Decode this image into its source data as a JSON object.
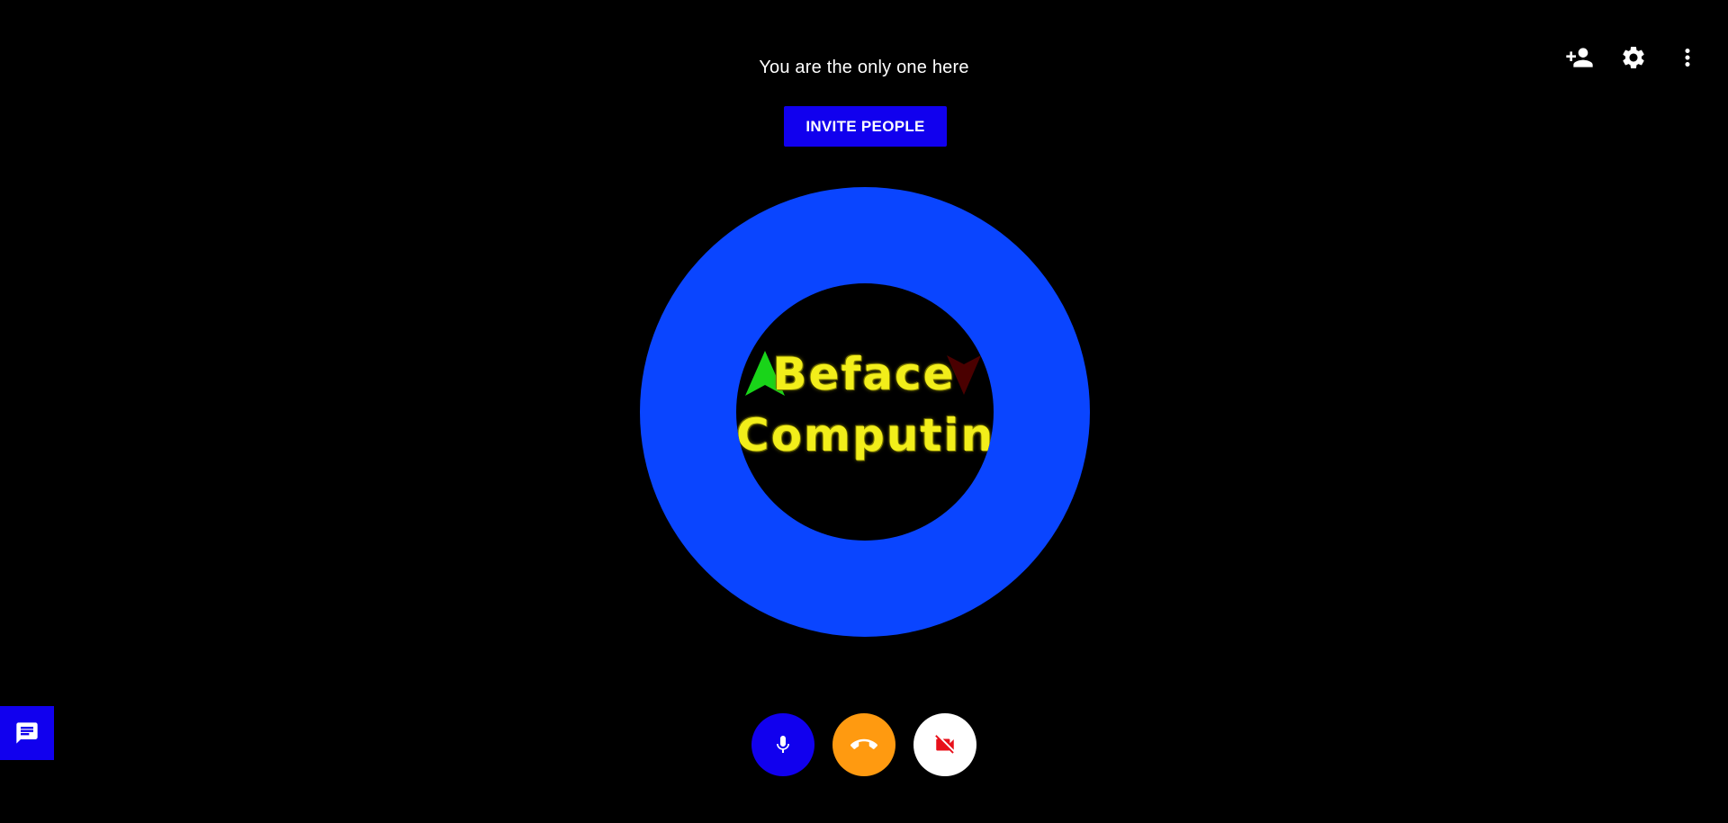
{
  "status": {
    "message": "You are the only one here"
  },
  "invite": {
    "label": "INVITE PEOPLE"
  },
  "top_actions": [
    {
      "icon": "add-person-icon"
    },
    {
      "icon": "gear-icon"
    },
    {
      "icon": "more-vert-icon"
    }
  ],
  "avatar": {
    "logo_line_1": "Beface",
    "logo_line_2": "Computing",
    "ring_color": "#0a45ff",
    "text_color": "#f2ee1a"
  },
  "chat": {
    "icon": "chat-icon"
  },
  "controls": [
    {
      "icon": "mic-icon",
      "color": "#1100ee"
    },
    {
      "icon": "hangup-icon",
      "color": "#ff9a10"
    },
    {
      "icon": "video-off-icon",
      "color": "#ffffff"
    }
  ],
  "colors": {
    "background": "#000000",
    "accent": "#1100ee"
  }
}
